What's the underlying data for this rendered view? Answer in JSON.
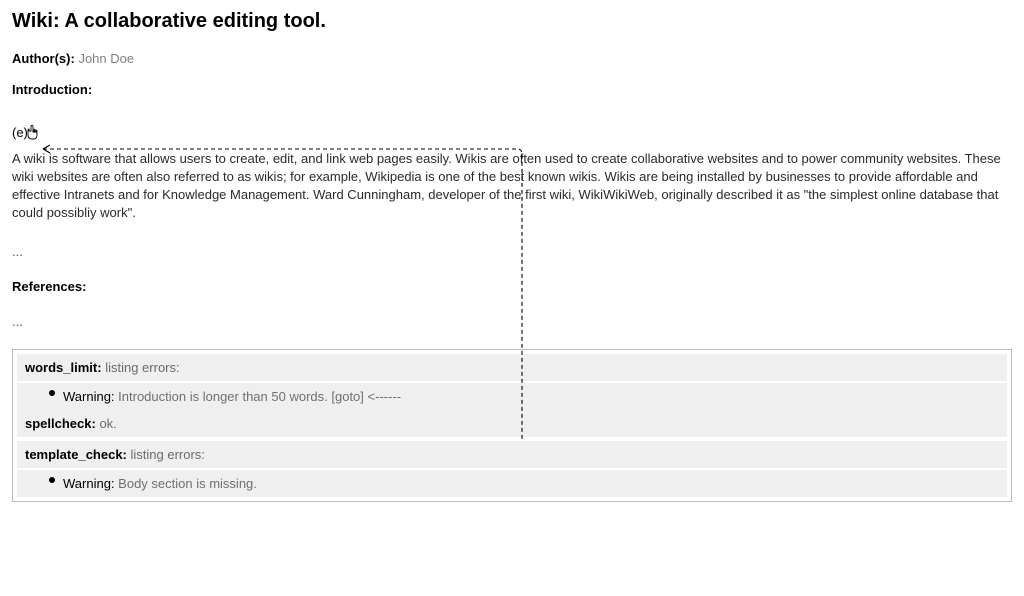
{
  "title": "Wiki: A collaborative editing tool.",
  "author_label": "Author(s):",
  "author_value": "John Doe",
  "intro_label": "Introduction:",
  "callout_marker": "(e)",
  "intro_text": "A wiki is software that allows users to create, edit, and link web pages easily. Wikis are often used to create collaborative websites and to power community websites. These wiki websites are often also referred to as wikis; for example, Wikipedia is one of the best known wikis. Wikis are being installed by businesses to provide affordable and effective Intranets and for Knowledge Management. Ward Cunningham, developer of the first wiki, WikiWikiWeb, originally described it as \"the simplest online database that could possibliy work\".",
  "ellipsis": "...",
  "refs_label": "References:",
  "validators": {
    "words_limit": {
      "name": "words_limit:",
      "status": "listing errors:",
      "warning_label": "Warning:",
      "warning_text": "Introduction is longer than 50 words.",
      "goto": "[goto]"
    },
    "spellcheck": {
      "name": "spellcheck:",
      "status": "ok."
    },
    "template_check": {
      "name": "template_check:",
      "status": "listing errors:",
      "warning_label": "Warning:",
      "warning_text": "Body section is missing."
    }
  },
  "annotation_arrow_tail": "<------"
}
